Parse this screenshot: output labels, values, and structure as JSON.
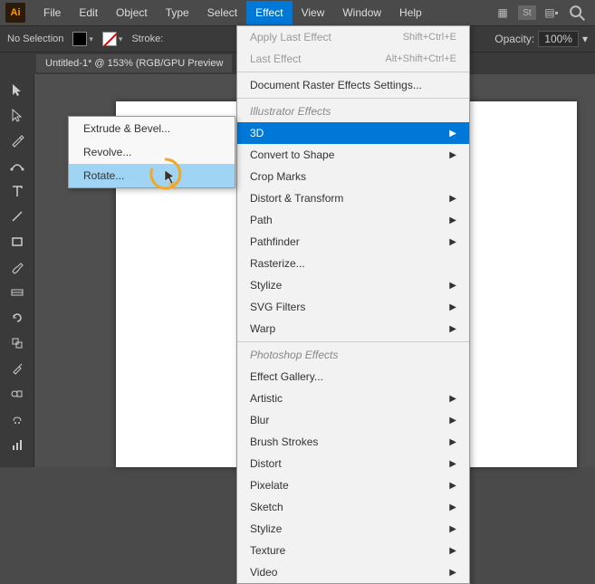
{
  "app": {
    "logo": "Ai"
  },
  "menu": {
    "items": [
      "File",
      "Edit",
      "Object",
      "Type",
      "Select",
      "Effect",
      "View",
      "Window",
      "Help"
    ],
    "activeIndex": 5
  },
  "topbar": {
    "selection": "No Selection",
    "strokeLabel": "Stroke:",
    "opacityLabel": "Opacity:",
    "opacityValue": "100%"
  },
  "tab": {
    "title": "Untitled-1* @ 153% (RGB/GPU Preview"
  },
  "effectMenu": {
    "applyLast": "Apply Last Effect",
    "applyLastShortcut": "Shift+Ctrl+E",
    "lastEffect": "Last Effect",
    "lastEffectShortcut": "Alt+Shift+Ctrl+E",
    "docRaster": "Document Raster Effects Settings...",
    "illHeader": "Illustrator Effects",
    "items": [
      {
        "label": "3D",
        "sub": true,
        "hl": true
      },
      {
        "label": "Convert to Shape",
        "sub": true
      },
      {
        "label": "Crop Marks",
        "sub": false
      },
      {
        "label": "Distort & Transform",
        "sub": true
      },
      {
        "label": "Path",
        "sub": true
      },
      {
        "label": "Pathfinder",
        "sub": true
      },
      {
        "label": "Rasterize...",
        "sub": false
      },
      {
        "label": "Stylize",
        "sub": true
      },
      {
        "label": "SVG Filters",
        "sub": true
      },
      {
        "label": "Warp",
        "sub": true
      }
    ],
    "psHeader": "Photoshop Effects",
    "psItems": [
      {
        "label": "Effect Gallery...",
        "sub": false
      },
      {
        "label": "Artistic",
        "sub": true
      },
      {
        "label": "Blur",
        "sub": true
      },
      {
        "label": "Brush Strokes",
        "sub": true
      },
      {
        "label": "Distort",
        "sub": true
      },
      {
        "label": "Pixelate",
        "sub": true
      },
      {
        "label": "Sketch",
        "sub": true
      },
      {
        "label": "Stylize",
        "sub": true
      },
      {
        "label": "Texture",
        "sub": true
      },
      {
        "label": "Video",
        "sub": true
      }
    ]
  },
  "submenu3d": {
    "items": [
      "Extrude & Bevel...",
      "Revolve...",
      "Rotate..."
    ],
    "highlightIndex": 2
  },
  "tools": [
    "selection",
    "direct-select",
    "pen",
    "curvature",
    "type",
    "line",
    "rectangle",
    "brush",
    "gradient",
    "rotate",
    "scale",
    "eyedropper",
    "blend",
    "symbol",
    "column-graph"
  ]
}
